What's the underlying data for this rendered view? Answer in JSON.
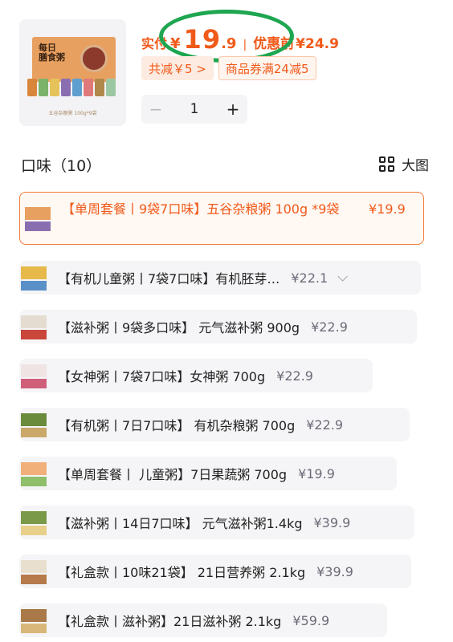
{
  "product": {
    "thumb_brand": "每日\n膳食粥",
    "thumb_caption": "五谷杂粮粥 100g*9袋"
  },
  "price": {
    "label": "实付",
    "currency": "¥",
    "integer": "19",
    "decimal": ".9",
    "separator": "|",
    "original_label": "优惠前",
    "original_price": "¥24.9"
  },
  "discounts": {
    "total": "共减￥5 >",
    "coupon": "商品券满24减5"
  },
  "quantity": {
    "minus": "−",
    "value": "1",
    "plus": "+"
  },
  "flavor_section": {
    "title": "口味（10）",
    "view_label": "大图"
  },
  "options": [
    {
      "name": "【单周套餐丨9袋7口味】五谷杂粮粥 100g *9袋",
      "price": "¥19.9",
      "selected": true
    },
    {
      "name": "【有机儿童粥丨7袋7口味】有机胚芽…",
      "price": "¥22.1"
    },
    {
      "name": "【滋补粥丨9袋多口味】 元气滋补粥 900g",
      "price": "¥22.9"
    },
    {
      "name": "【女神粥丨7袋7口味】女神粥 700g",
      "price": "¥22.9"
    },
    {
      "name": "【有机粥丨7日7口味】 有机杂粮粥 700g",
      "price": "¥22.9"
    },
    {
      "name": "【单周套餐丨 儿童粥】7日果蔬粥 700g",
      "price": "¥19.9"
    },
    {
      "name": "【滋补粥丨14日7口味】 元气滋补粥1.4kg",
      "price": "¥39.9"
    },
    {
      "name": "【礼盒款丨10味21袋】 21日营养粥 2.1kg",
      "price": "¥39.9"
    },
    {
      "name": "【礼盒款丨滋补粥】21日滋补粥 2.1kg",
      "price": "¥59.9"
    }
  ],
  "colors": {
    "accent": "#f05a1a",
    "highlight_circle": "#1ea650",
    "option_bg": "#f5f5f7"
  }
}
